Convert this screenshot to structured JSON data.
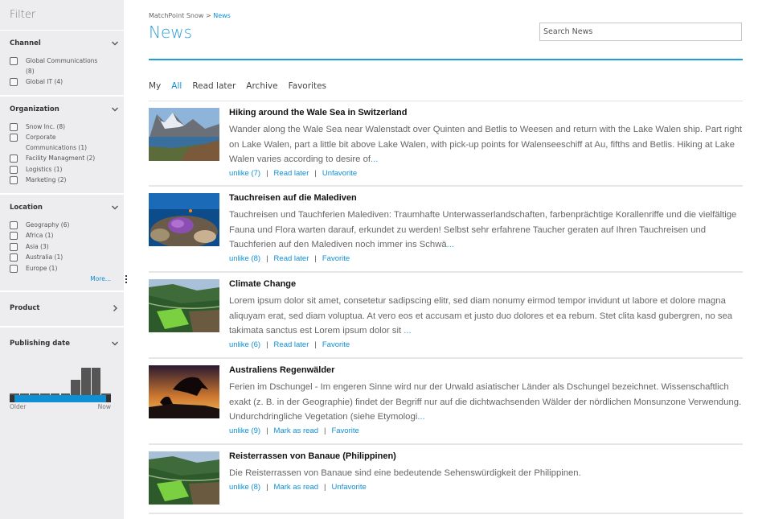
{
  "sidebar": {
    "title": "Filter",
    "sections": [
      {
        "title": "Channel",
        "expanded": true,
        "options": [
          "Global Communications (8)",
          "Global IT (4)"
        ]
      },
      {
        "title": "Organization",
        "expanded": true,
        "options": [
          "Snow Inc. (8)",
          "Corporate Communications (1)",
          "Facility Managment (2)",
          "Logistics (1)",
          "Marketing (2)"
        ]
      },
      {
        "title": "Location",
        "expanded": true,
        "options": [
          "Geography (6)",
          "Africa (1)",
          "Asia (3)",
          "Australia (1)",
          "Europe (1)"
        ],
        "more_label": "More..."
      },
      {
        "title": "Product",
        "expanded": false
      },
      {
        "title": "Publishing date",
        "expanded": true,
        "older_label": "Older",
        "now_label": "Now",
        "histogram_relative": [
          0.03,
          0.03,
          0.03,
          0.03,
          0.03,
          0.03,
          0.55,
          1.0,
          1.0,
          0.03
        ]
      }
    ]
  },
  "header": {
    "breadcrumb_root": "MatchPoint Snow",
    "breadcrumb_sep": " > ",
    "breadcrumb_current": "News",
    "title": "News",
    "search_placeholder": "Search News"
  },
  "tabs": [
    {
      "label": "My",
      "active": false
    },
    {
      "label": "All",
      "active": true
    },
    {
      "label": "Read later",
      "active": false
    },
    {
      "label": "Archive",
      "active": false
    },
    {
      "label": "Favorites",
      "active": false
    }
  ],
  "colors": {
    "accent": "#0f8fd4",
    "title_blue": "#2a9fd8",
    "sidebar_bg": "#ededf0"
  },
  "news": [
    {
      "title": "Hiking around the Wale Sea in Switzerland",
      "text": "Wander along the Wale Sea near Walenstadt over Quinten and Betlis to Weesen and return with the Lake Walen ship. Part right on Lake Walen, part a little bit above Lake Walen, with pick-up points for Walenseeschiff at Au, fifths and Betlis. Hiking at Lake Walen varies according to desire of",
      "ellipsis": "...",
      "image": "mountain-lake-image",
      "actions": [
        "unlike (7)",
        "Read later",
        "Unfavorite"
      ]
    },
    {
      "title": "Tauchreisen auf die Malediven",
      "text": "Tauchreisen und Tauchferien Malediven: Traumhafte Unterwasserlandschaften, farbenprächtige Korallenriffe und die vielfältige Fauna und Flora warten darauf, erkundet zu werden! Selbst sehr erfahrene Taucher geraten auf Ihren Tauchreisen und Tauchferien auf den Malediven noch immer ins Schwä",
      "ellipsis": "...",
      "image": "coral-reef-image",
      "actions": [
        "unlike (8)",
        "Read later",
        "Favorite"
      ]
    },
    {
      "title": "Climate Change",
      "text": "Lorem ipsum dolor sit amet, consetetur sadipscing elitr, sed diam nonumy eirmod tempor invidunt ut labore et dolore magna aliquyam erat, sed diam voluptua. At vero eos et accusam et justo duo dolores et ea rebum. Stet clita kasd gubergren, no sea takimata sanctus est Lorem ipsum dolor sit ",
      "ellipsis": "...",
      "image": "rice-terraces-image",
      "actions": [
        "unlike (6)",
        "Read later",
        "Favorite"
      ]
    },
    {
      "title": "Australiens Regenwälder",
      "text": "Ferien im Dschungel - Im engeren Sinne wird nur der Urwald asiatischer Länder als Dschungel bezeichnet. Wissenschaftlich exakt (z. B. in der Geographie) findet der Begriff nur auf die dichtwachsenden Wälder der nördlichen Monsunzone Verwendung. Undurchdringliche Vegetation (siehe Etymologi",
      "ellipsis": "...",
      "image": "kangaroo-sunset-image",
      "actions": [
        "unlike (9)",
        "Mark as read",
        "Favorite"
      ]
    },
    {
      "title": "Reisterrassen von Banaue (Philippinen)",
      "text": "Die Reisterrassen von Banaue sind eine bedeutende Sehenswürdigkeit der Philippinen.",
      "ellipsis": "",
      "image": "rice-terraces-image",
      "actions": [
        "unlike (8)",
        "Mark as read",
        "Unfavorite"
      ]
    }
  ]
}
